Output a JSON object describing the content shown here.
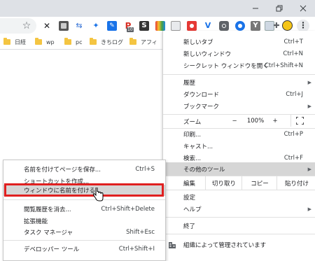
{
  "toolbar": {
    "bookmark_icon": "star-icon",
    "extension_badge": "10",
    "extension_letters": [
      "P",
      "S",
      "Y"
    ]
  },
  "bookmarks": [
    {
      "label": "日経"
    },
    {
      "label": "wp"
    },
    {
      "label": "pc"
    },
    {
      "label": "きちログ"
    },
    {
      "label": "アフィ"
    }
  ],
  "menu": {
    "new_tab": {
      "label": "新しいタブ",
      "shortcut": "Ctrl+T"
    },
    "new_window": {
      "label": "新しいウィンドウ",
      "shortcut": "Ctrl+N"
    },
    "incognito": {
      "label": "シークレット ウィンドウを開く",
      "shortcut": "Ctrl+Shift+N"
    },
    "history": {
      "label": "履歴"
    },
    "downloads": {
      "label": "ダウンロード",
      "shortcut": "Ctrl+J"
    },
    "bookmarks": {
      "label": "ブックマーク"
    },
    "zoom": {
      "label": "ズーム",
      "minus": "−",
      "value": "100%",
      "plus": "+"
    },
    "print": {
      "label": "印刷...",
      "shortcut": "Ctrl+P"
    },
    "cast": {
      "label": "キャスト..."
    },
    "find": {
      "label": "検索...",
      "shortcut": "Ctrl+F"
    },
    "more_tools": {
      "label": "その他のツール"
    },
    "edit": {
      "label": "編集",
      "cut": "切り取り",
      "copy": "コピー",
      "paste": "貼り付け"
    },
    "settings": {
      "label": "設定"
    },
    "help": {
      "label": "ヘルプ"
    },
    "exit": {
      "label": "終了"
    },
    "managed": {
      "label": "組織によって管理されています"
    }
  },
  "submenu": {
    "save_page": {
      "label": "名前を付けてページを保存...",
      "shortcut": "Ctrl+S"
    },
    "create_shortcut": {
      "label": "ショートカットを作成..."
    },
    "name_window": {
      "label": "ウィンドウに名前を付ける..."
    },
    "clear_data": {
      "label": "閲覧履歴を消去...",
      "shortcut": "Ctrl+Shift+Delete"
    },
    "extensions": {
      "label": "拡張機能"
    },
    "task_manager": {
      "label": "タスク マネージャ",
      "shortcut": "Shift+Esc"
    },
    "devtools": {
      "label": "デベロッパー ツール",
      "shortcut": "Ctrl+Shift+I"
    }
  },
  "colors": {
    "highlight_frame": "#e02020",
    "menu_hover": "#d6d6d6",
    "titlebar": "#dee1e6"
  }
}
